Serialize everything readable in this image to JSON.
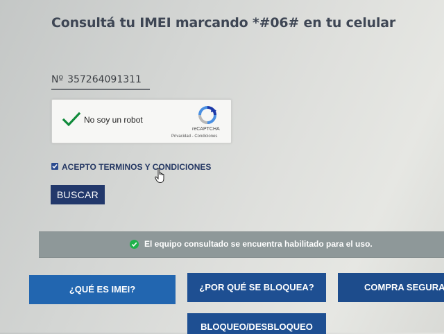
{
  "page": {
    "title": "Consultá tu IMEI marcando *#06# en tu celular"
  },
  "imei": {
    "prefix": "Nº",
    "value": "357264091311"
  },
  "recaptcha": {
    "label": "No soy un robot",
    "brand": "reCAPTCHA",
    "links": "Privacidad - Condiciones",
    "checked": true
  },
  "terms": {
    "label": "ACEPTO TERMINOS Y CONDICIONES",
    "checked": true
  },
  "search": {
    "label": "BUSCAR"
  },
  "status": {
    "message": "El equipo consultado se encuentra habilitado para el uso.",
    "icon": "check-circle-icon",
    "color": "#8e9899"
  },
  "nav": {
    "que_es": "¿QUÉ ES IMEI?",
    "por_que": "¿POR QUÉ SE BLOQUEA?",
    "compra": "COMPRA SEGURA",
    "bloqueo": "BLOQUEO/DESBLOQUEO"
  },
  "colors": {
    "primary": "#22386b",
    "nav_blue": "#1f5aa3",
    "title_text": "#3e4654",
    "recaptcha_check": "#0f8a3a"
  }
}
